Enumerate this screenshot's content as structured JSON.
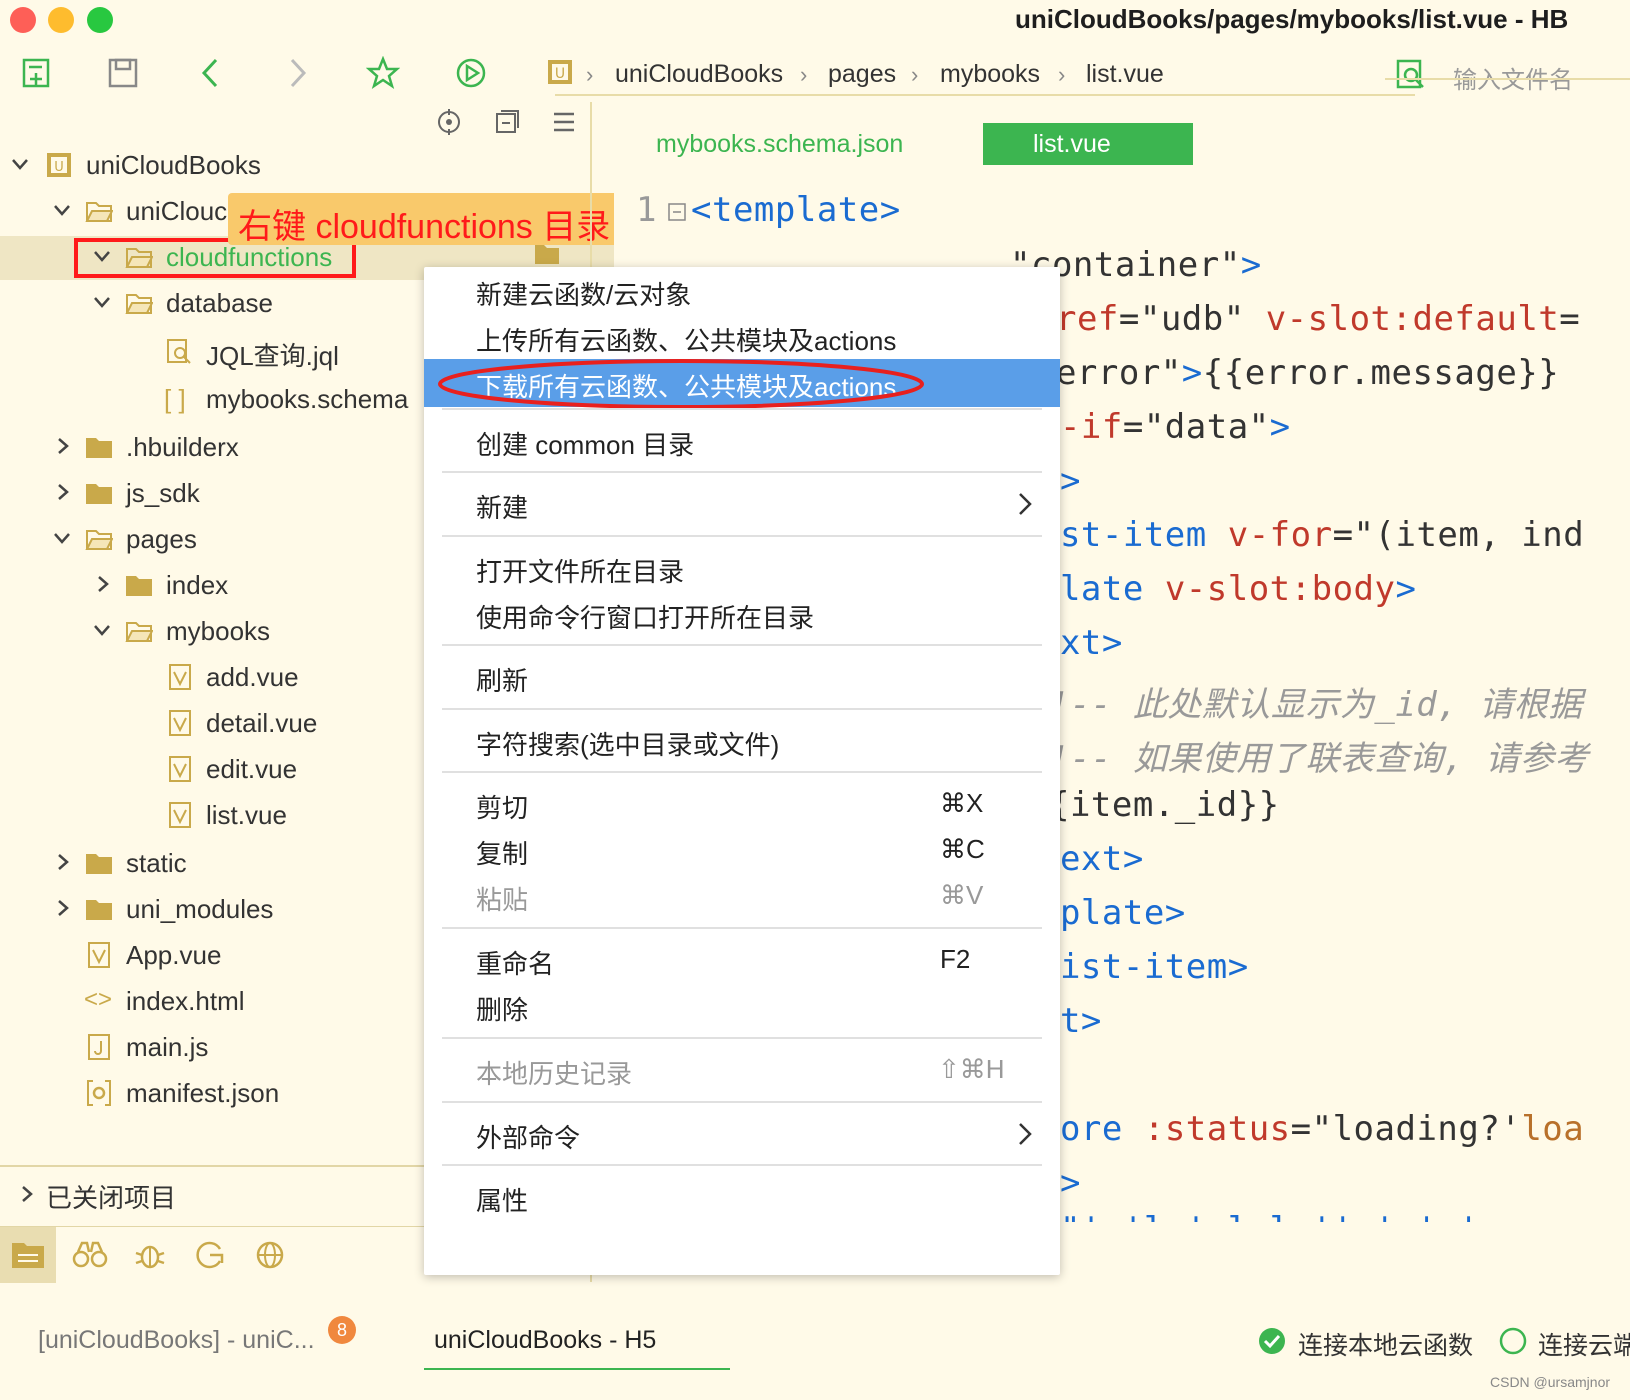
{
  "window": {
    "title": "uniCloudBooks/pages/mybooks/list.vue - HB"
  },
  "toolbar": {
    "breadcrumb": [
      "uniCloudBooks",
      "pages",
      "mybooks",
      "list.vue"
    ],
    "file_search_placeholder": "输入文件名"
  },
  "annotation": {
    "text": "右键 cloudfunctions 目录"
  },
  "sidebar": {
    "items": [
      {
        "label": "uniCloudBooks"
      },
      {
        "label": "uniClouc"
      },
      {
        "label": "cloudfunctions"
      },
      {
        "label": "database"
      },
      {
        "label": "JQL查询.jql"
      },
      {
        "label": "mybooks.schema"
      },
      {
        "label": ".hbuilderx"
      },
      {
        "label": "js_sdk"
      },
      {
        "label": "pages"
      },
      {
        "label": "index"
      },
      {
        "label": "mybooks"
      },
      {
        "label": "add.vue"
      },
      {
        "label": "detail.vue"
      },
      {
        "label": "edit.vue"
      },
      {
        "label": "list.vue"
      },
      {
        "label": "static"
      },
      {
        "label": "uni_modules"
      },
      {
        "label": "App.vue"
      },
      {
        "label": "index.html"
      },
      {
        "label": "main.js"
      },
      {
        "label": "manifest.json"
      }
    ],
    "closed_projects": "已关闭项目"
  },
  "editor": {
    "tabs": [
      {
        "label": "mybooks.schema.json",
        "active": false
      },
      {
        "label": "list.vue",
        "active": true
      }
    ],
    "line_number": "1"
  },
  "context_menu": {
    "items": [
      {
        "label": "新建云函数/云对象",
        "shortcut": ""
      },
      {
        "label": "上传所有云函数、公共模块及actions",
        "shortcut": ""
      },
      {
        "label": "下载所有云函数、公共模块及actions",
        "shortcut": "",
        "highlighted": true
      },
      {
        "label": "创建 common 目录",
        "shortcut": ""
      },
      {
        "label": "新建",
        "shortcut": "",
        "submenu": true
      },
      {
        "label": "打开文件所在目录",
        "shortcut": ""
      },
      {
        "label": "使用命令行窗口打开所在目录",
        "shortcut": ""
      },
      {
        "label": "刷新",
        "shortcut": ""
      },
      {
        "label": "字符搜索(选中目录或文件)",
        "shortcut": ""
      },
      {
        "label": "剪切",
        "shortcut": "⌘X"
      },
      {
        "label": "复制",
        "shortcut": "⌘C"
      },
      {
        "label": "粘贴",
        "shortcut": "⌘V",
        "disabled": true
      },
      {
        "label": "重命名",
        "shortcut": "F2"
      },
      {
        "label": "删除",
        "shortcut": ""
      },
      {
        "label": "本地历史记录",
        "shortcut": "⇧⌘H",
        "disabled": true
      },
      {
        "label": "外部命令",
        "shortcut": "",
        "submenu": true
      },
      {
        "label": "属性",
        "shortcut": ""
      }
    ]
  },
  "statusbar": {
    "tabs": [
      {
        "label": "[uniCloudBooks] - uniC..."
      },
      {
        "label": "uniCloudBooks - H5"
      }
    ],
    "badge_count": "8",
    "connect_local": "连接本地云函数",
    "connect_cloud": "连接云端",
    "watermark": "CSDN @ursamjnor"
  },
  "colors": {
    "background": "#fffae8",
    "accent_green": "#3cb550",
    "menu_highlight": "#5a9ee8",
    "annotation_red": "#ff1a1a",
    "annotation_bg": "#f9c96b"
  }
}
